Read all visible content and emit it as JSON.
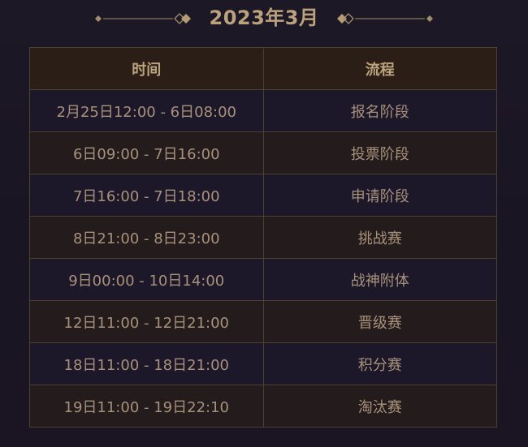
{
  "title": "2023年3月",
  "colors": {
    "background": "#1c1725",
    "gold": "#bba27c",
    "border": "#4f4034",
    "header_bg": "#2a1e17",
    "row_dark": "#1d1829",
    "row_light": "#241c1c"
  },
  "table": {
    "headers": [
      "时间",
      "流程"
    ],
    "rows": [
      {
        "time": "2月25日12:00 - 6日08:00",
        "stage": "报名阶段"
      },
      {
        "time": "6日09:00 - 7日16:00",
        "stage": "投票阶段"
      },
      {
        "time": "7日16:00 - 7日18:00",
        "stage": "申请阶段"
      },
      {
        "time": "8日21:00 - 8日23:00",
        "stage": "挑战赛"
      },
      {
        "time": "9日00:00 - 10日14:00",
        "stage": "战神附体"
      },
      {
        "time": "12日11:00 - 12日21:00",
        "stage": "晋级赛"
      },
      {
        "time": "18日11:00 - 18日21:00",
        "stage": "积分赛"
      },
      {
        "time": "19日11:00 - 19日22:10",
        "stage": "淘汰赛"
      }
    ]
  }
}
